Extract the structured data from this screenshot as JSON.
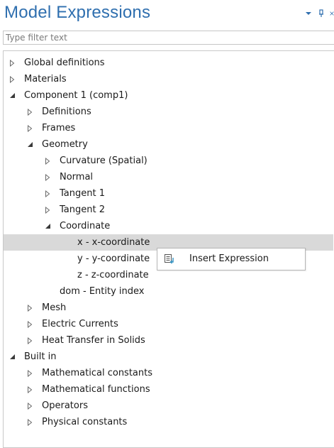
{
  "panel": {
    "title": "Model Expressions",
    "filter_placeholder": "Type filter text"
  },
  "header_icons": [
    "dropdown-arrow-icon",
    "pin-icon",
    "close-icon"
  ],
  "tree": [
    {
      "label": "Global definitions",
      "depth": 0,
      "toggle": "collapsed"
    },
    {
      "label": "Materials",
      "depth": 0,
      "toggle": "collapsed"
    },
    {
      "label": "Component 1 (comp1)",
      "depth": 0,
      "toggle": "expanded"
    },
    {
      "label": "Definitions",
      "depth": 1,
      "toggle": "collapsed"
    },
    {
      "label": "Frames",
      "depth": 1,
      "toggle": "collapsed"
    },
    {
      "label": "Geometry",
      "depth": 1,
      "toggle": "expanded"
    },
    {
      "label": "Curvature (Spatial)",
      "depth": 2,
      "toggle": "collapsed"
    },
    {
      "label": "Normal",
      "depth": 2,
      "toggle": "collapsed"
    },
    {
      "label": "Tangent 1",
      "depth": 2,
      "toggle": "collapsed"
    },
    {
      "label": "Tangent 2",
      "depth": 2,
      "toggle": "collapsed"
    },
    {
      "label": "Coordinate",
      "depth": 2,
      "toggle": "expanded"
    },
    {
      "label": "x - x-coordinate",
      "depth": 3,
      "toggle": "none",
      "selected": true
    },
    {
      "label": "y - y-coordinate",
      "depth": 3,
      "toggle": "none"
    },
    {
      "label": "z - z-coordinate",
      "depth": 3,
      "toggle": "none"
    },
    {
      "label": "dom - Entity index",
      "depth": 2,
      "toggle": "none"
    },
    {
      "label": "Mesh",
      "depth": 1,
      "toggle": "collapsed"
    },
    {
      "label": "Electric Currents",
      "depth": 1,
      "toggle": "collapsed"
    },
    {
      "label": "Heat Transfer in Solids",
      "depth": 1,
      "toggle": "collapsed"
    },
    {
      "label": "Built in",
      "depth": 0,
      "toggle": "expanded"
    },
    {
      "label": "Mathematical constants",
      "depth": 1,
      "toggle": "collapsed"
    },
    {
      "label": "Mathematical functions",
      "depth": 1,
      "toggle": "collapsed"
    },
    {
      "label": "Operators",
      "depth": 1,
      "toggle": "collapsed"
    },
    {
      "label": "Physical constants",
      "depth": 1,
      "toggle": "collapsed"
    }
  ],
  "context_menu": {
    "items": [
      {
        "label": "Insert Expression",
        "icon": "insert-expression-icon"
      }
    ]
  },
  "colors": {
    "title": "#2f6faf",
    "selected_row": "#d9d9d9",
    "arrow": "#6a6a6a",
    "expanded_arrow": "#3a3a3a"
  }
}
